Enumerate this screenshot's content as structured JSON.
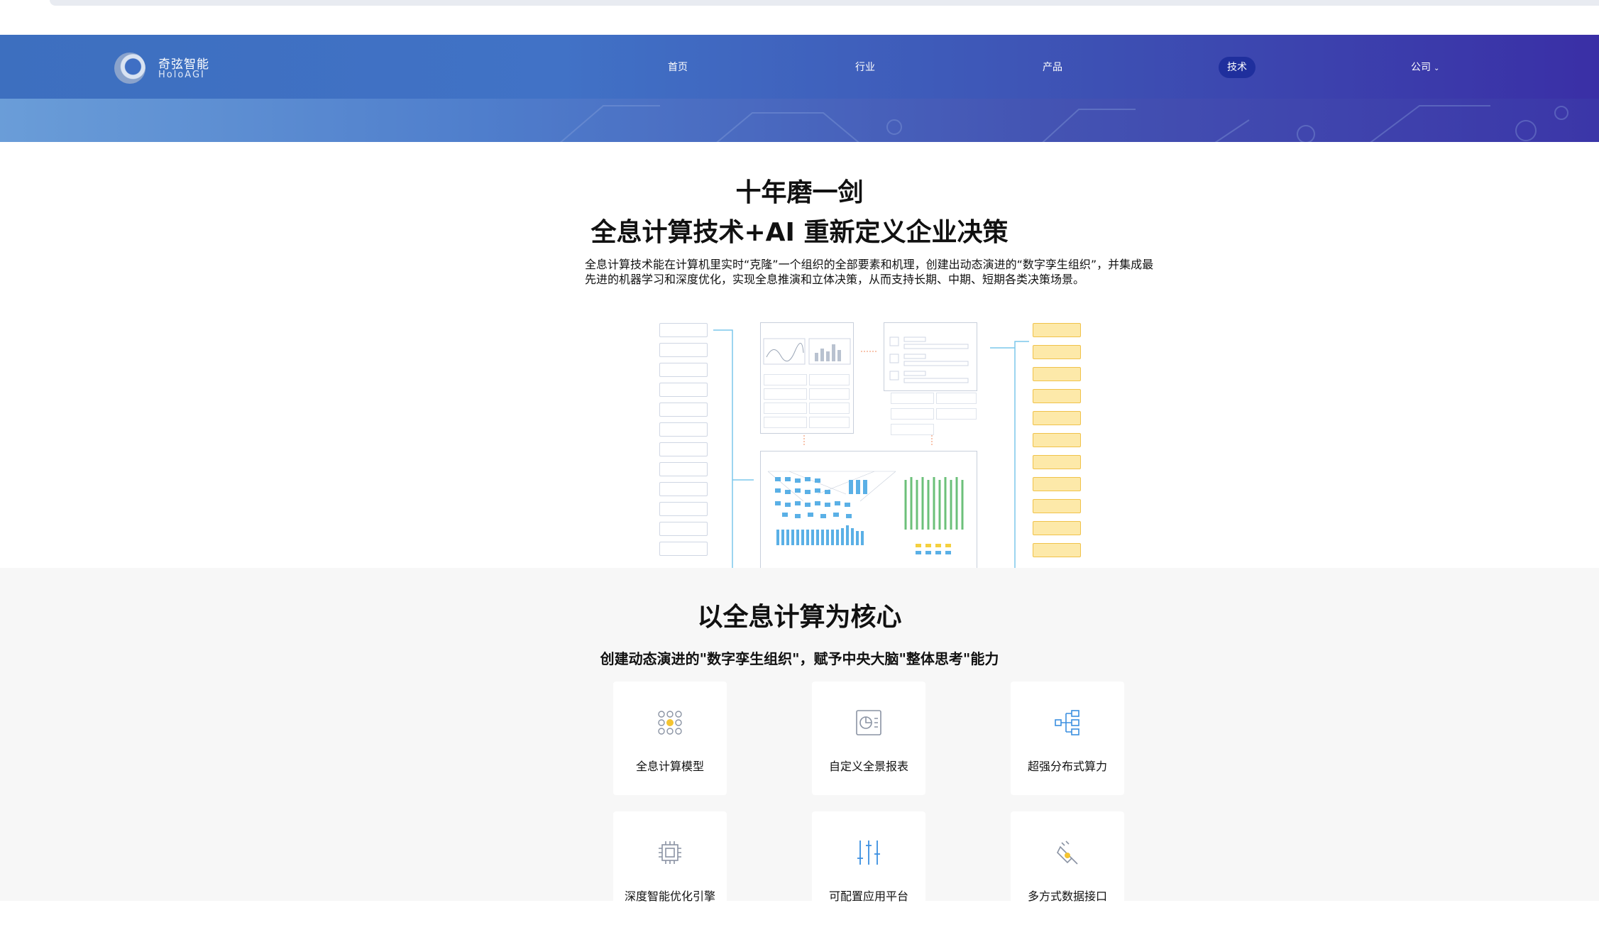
{
  "logo": {
    "cn": "奇弦智能",
    "en": "HoloAGI"
  },
  "nav": {
    "items": [
      {
        "label": "首页",
        "active": false
      },
      {
        "label": "行业",
        "active": false
      },
      {
        "label": "产品",
        "active": false
      },
      {
        "label": "技术",
        "active": true
      },
      {
        "label": "公司",
        "active": false,
        "dropdown": true
      }
    ]
  },
  "section1": {
    "title1": "十年磨一剑",
    "title2": "全息计算技术+AI 重新定义企业决策",
    "description": "全息计算技术能在计算机里实时“克隆”一个组织的全部要素和机理，创建出动态演进的“数字孪生组织”，并集成最先进的机器学习和深度优化，实现全息推演和立体决策，从而支持长期、中期、短期各类决策场景。"
  },
  "section2": {
    "title": "以全息计算为核心",
    "subtitle": "创建动态演进的\"数字孪生组织\"，赋予中央大脑\"整体思考\"能力",
    "cards": [
      {
        "label": "全息计算模型",
        "icon": "network-nodes-icon"
      },
      {
        "label": "自定义全景报表",
        "icon": "report-chart-icon"
      },
      {
        "label": "超强分布式算力",
        "icon": "distributed-tree-icon"
      },
      {
        "label": "深度智能优化引擎",
        "icon": "chip-icon"
      },
      {
        "label": "可配置应用平台",
        "icon": "sliders-icon"
      },
      {
        "label": "多方式数据接口",
        "icon": "plug-icon"
      }
    ]
  },
  "colors": {
    "accent_blue": "#3d6fbf",
    "nav_active": "#1f2f9d",
    "diagram_yellow": "#fde9a9",
    "diagram_blue": "#5ab0e6",
    "diagram_green": "#6cc07a"
  }
}
